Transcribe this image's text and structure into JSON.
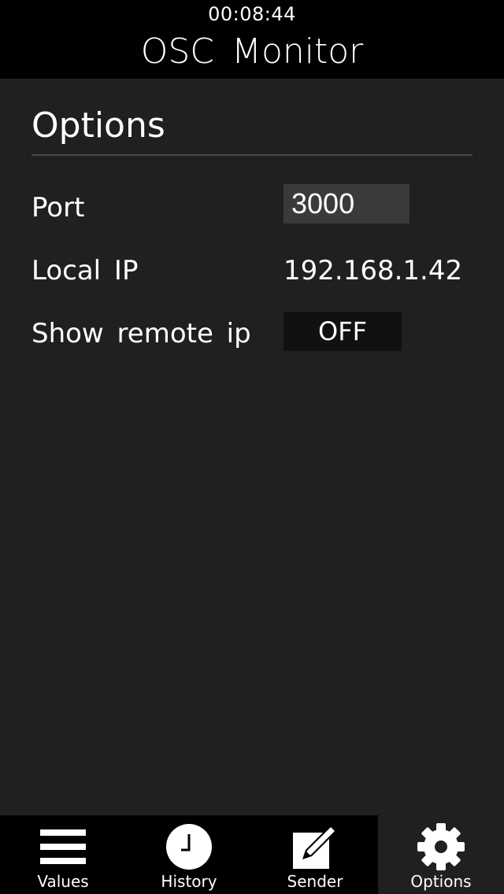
{
  "status": {
    "clock": "00:08:44"
  },
  "header": {
    "title": "OSC Monitor"
  },
  "options": {
    "section_title": "Options",
    "port": {
      "label": "Port",
      "value": "3000"
    },
    "local_ip": {
      "label": "Local IP",
      "value": "192.168.1.42"
    },
    "show_remote_ip": {
      "label": "Show remote ip",
      "value": "OFF"
    }
  },
  "tabbar": {
    "active": "Options",
    "tabs": [
      {
        "label": "Values",
        "icon": "menu-icon"
      },
      {
        "label": "History",
        "icon": "clock-icon"
      },
      {
        "label": "Sender",
        "icon": "edit-icon"
      },
      {
        "label": "Options",
        "icon": "gear-icon"
      }
    ]
  },
  "colors": {
    "background": "#202020",
    "header": "#000000",
    "input_bg": "#3a3a3a",
    "toggle_bg": "#111111"
  }
}
